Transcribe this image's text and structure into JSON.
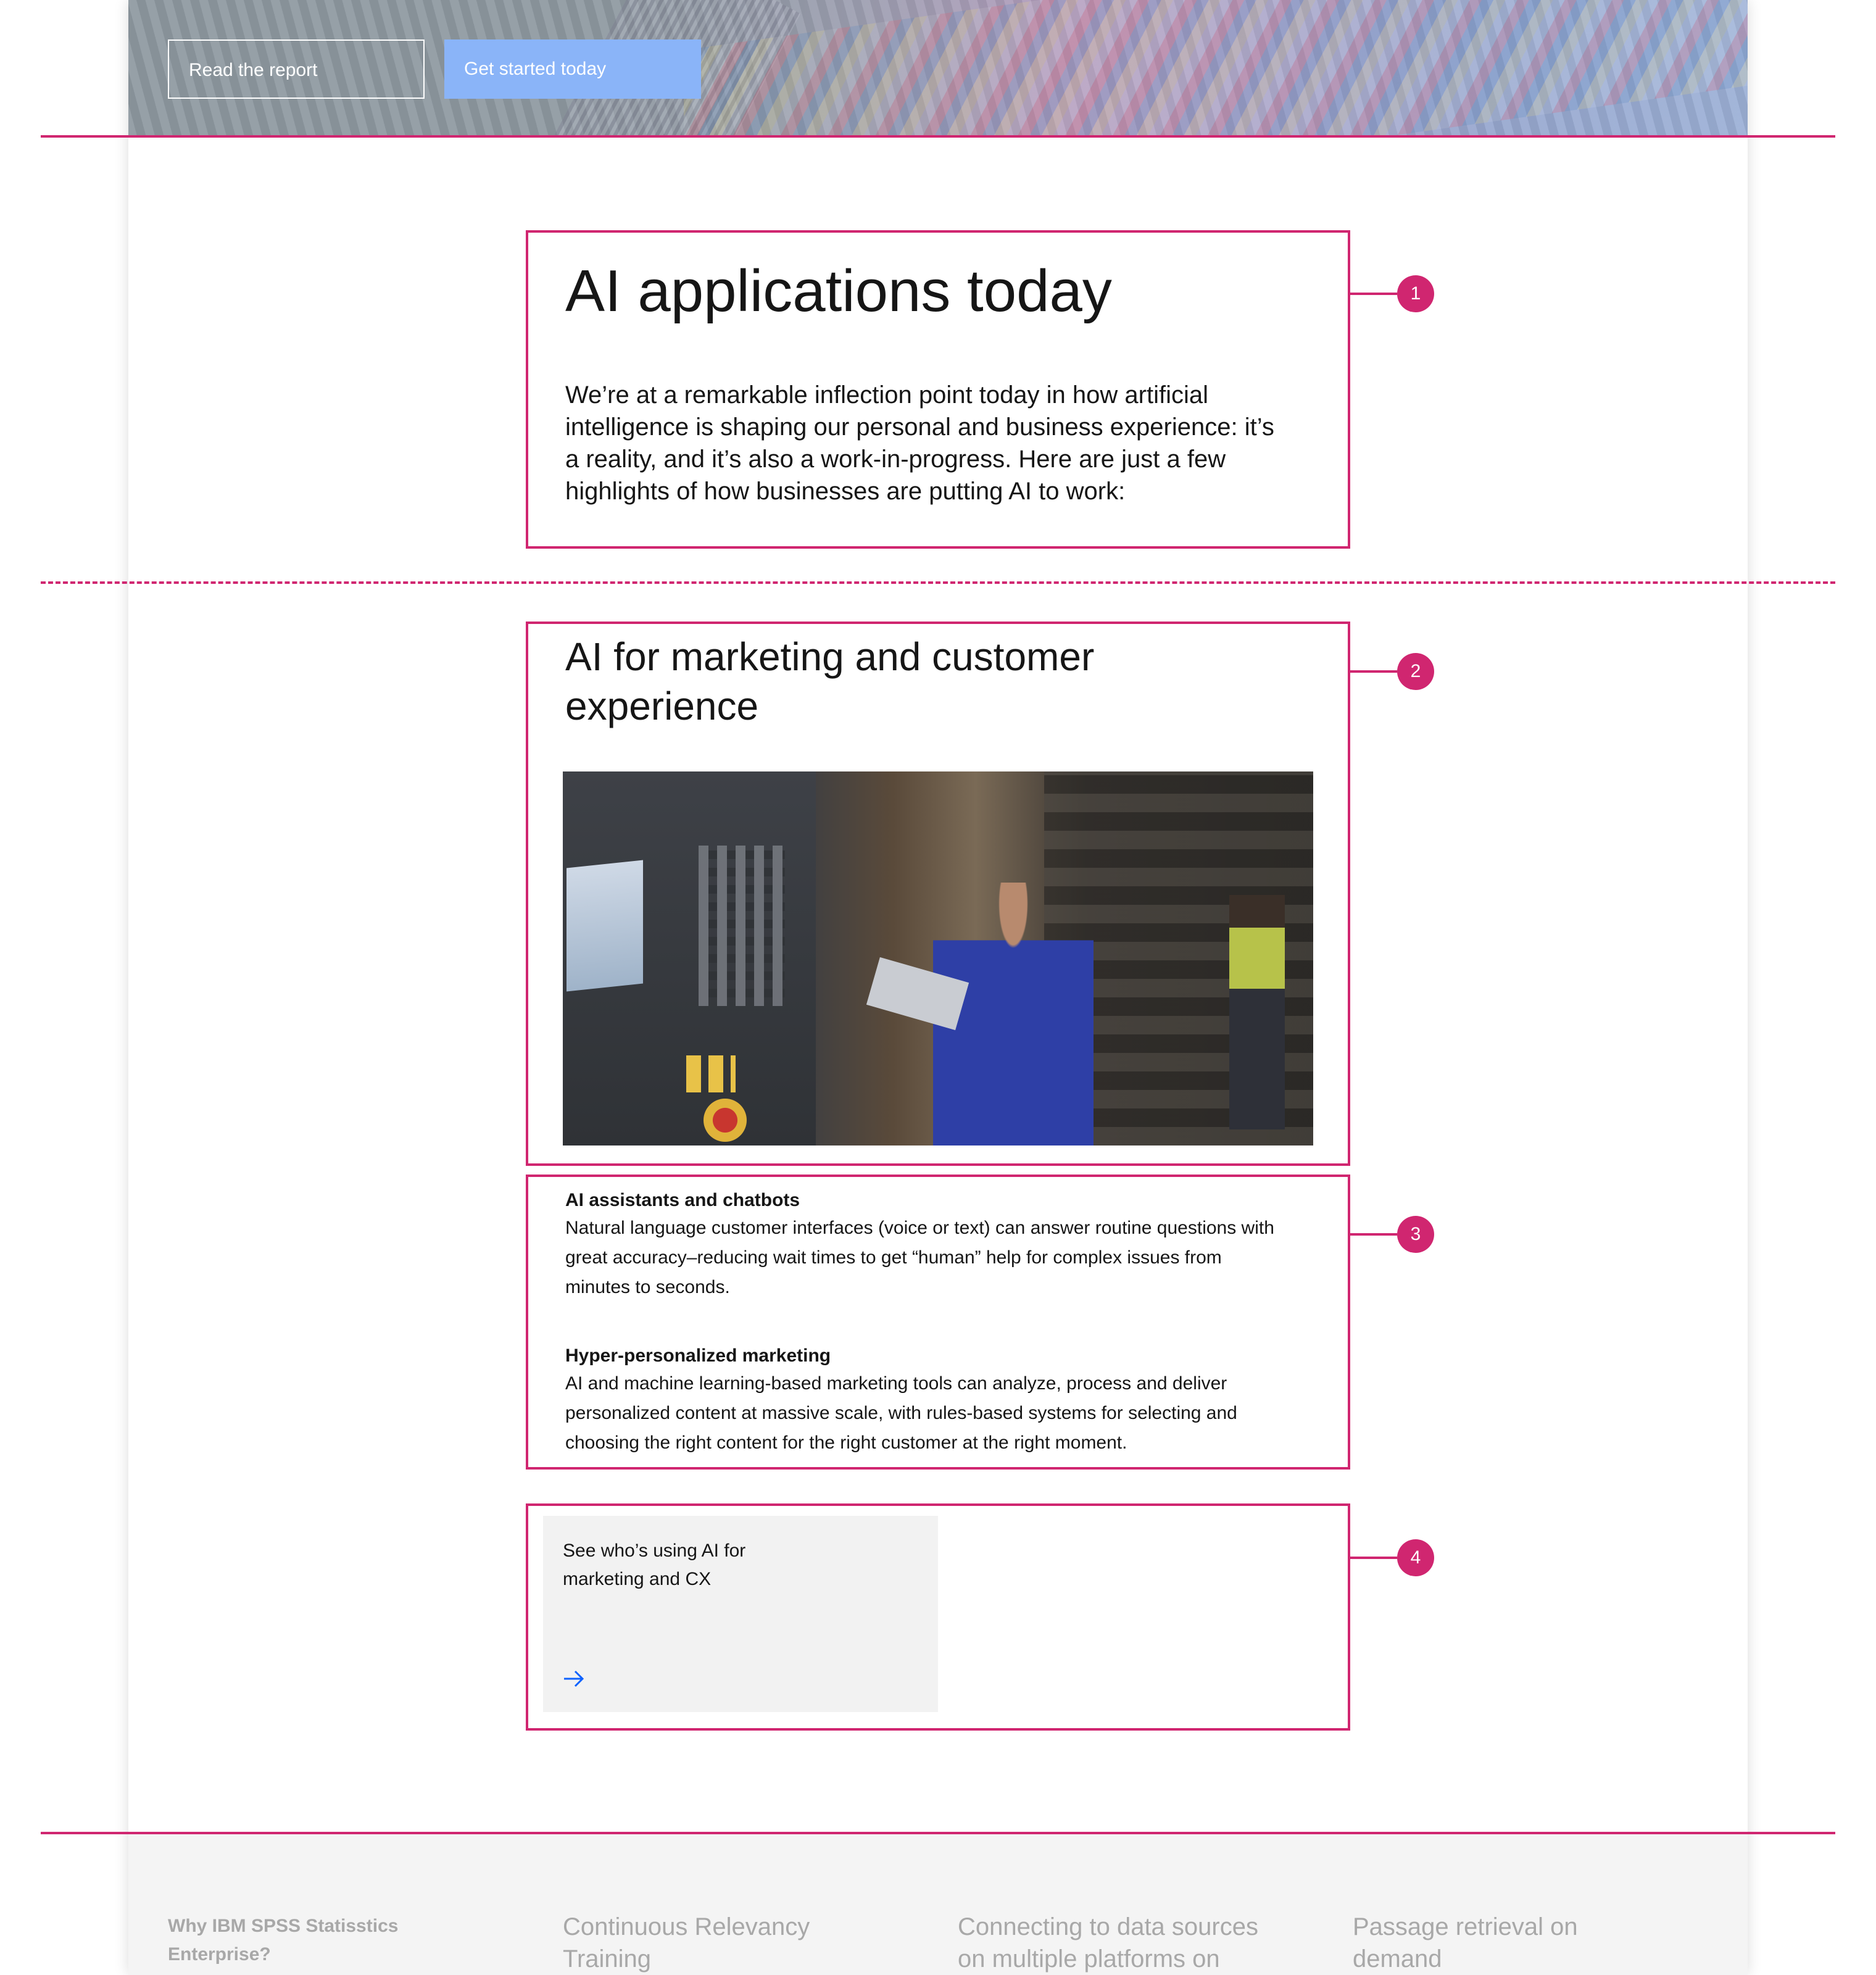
{
  "hero": {
    "read_report_label": "Read the report",
    "get_started_label": "Get started today"
  },
  "intro": {
    "heading": "AI applications today",
    "body": "We’re at a remarkable inflection point today in how artificial intelligence is shaping our personal and business experience: it’s a reality, and it’s also a work-in-progress. Here are just a few highlights of how businesses are putting AI to work:"
  },
  "section": {
    "heading": "AI for marketing and customer experience",
    "image_icon": "factory-worker-tablet-photo",
    "items": [
      {
        "title": "AI assistants and chatbots",
        "body": "Natural language customer interfaces (voice or text) can answer routine questions with great accuracy–reducing wait times to get “human” help for complex issues from minutes to seconds."
      },
      {
        "title": "Hyper-personalized marketing",
        "body": "AI and machine learning-based marketing tools can analyze, process and deliver personalized content at massive scale, with rules-based systems for selecting and choosing the right content for the right customer at the right moment."
      }
    ],
    "tile": {
      "text": "See who’s using AI for marketing and CX",
      "icon": "arrow-right-icon"
    }
  },
  "annotations": {
    "markers": [
      "1",
      "2",
      "3",
      "4"
    ],
    "color": "#d02670"
  },
  "footer": {
    "heading": "Why IBM SPSS Statisstics Enterprise?",
    "links": [
      "Continuous Relevancy Training",
      "Connecting to data sources on multiple platforms on",
      "Passage retrieval on demand"
    ]
  },
  "colors": {
    "accent": "#d02670",
    "primary_button": "#8ab4f8",
    "link_blue": "#0f62fe",
    "tile_bg": "#f2f2f2",
    "footer_bg": "#f4f4f4"
  }
}
